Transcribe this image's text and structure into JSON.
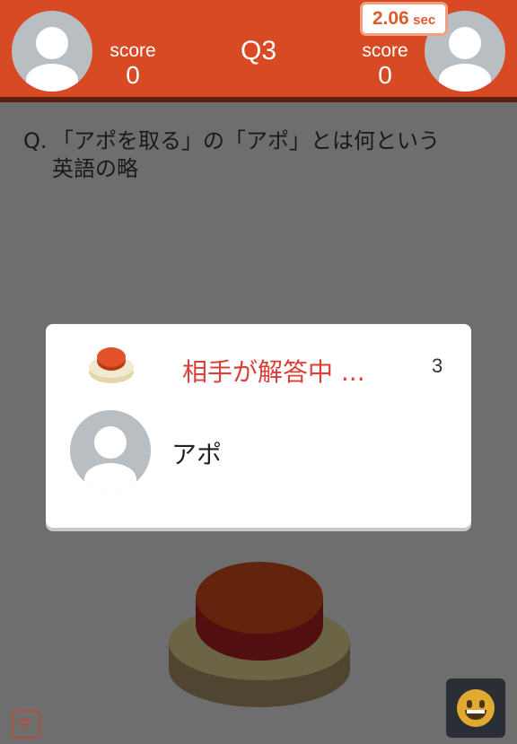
{
  "header": {
    "question_number": "Q3",
    "timer_value": "2.06",
    "timer_unit": "sec",
    "left_player": {
      "score_label": "score",
      "score": "0"
    },
    "right_player": {
      "score_label": "score",
      "score": "0"
    }
  },
  "question": {
    "prefix": "Q.",
    "line1": "「アポを取る」の「アポ」とは何という",
    "line2": "英語の略"
  },
  "dialog": {
    "status": "相手が解答中 ...",
    "countdown": "3",
    "answer": "アポ"
  },
  "colors": {
    "header": "#d84a23",
    "status_text": "#d9403a",
    "timer_text": "#e05a2a"
  },
  "icons": {
    "wifi": "wifi-icon",
    "emoji": "grin-emoji-icon"
  }
}
